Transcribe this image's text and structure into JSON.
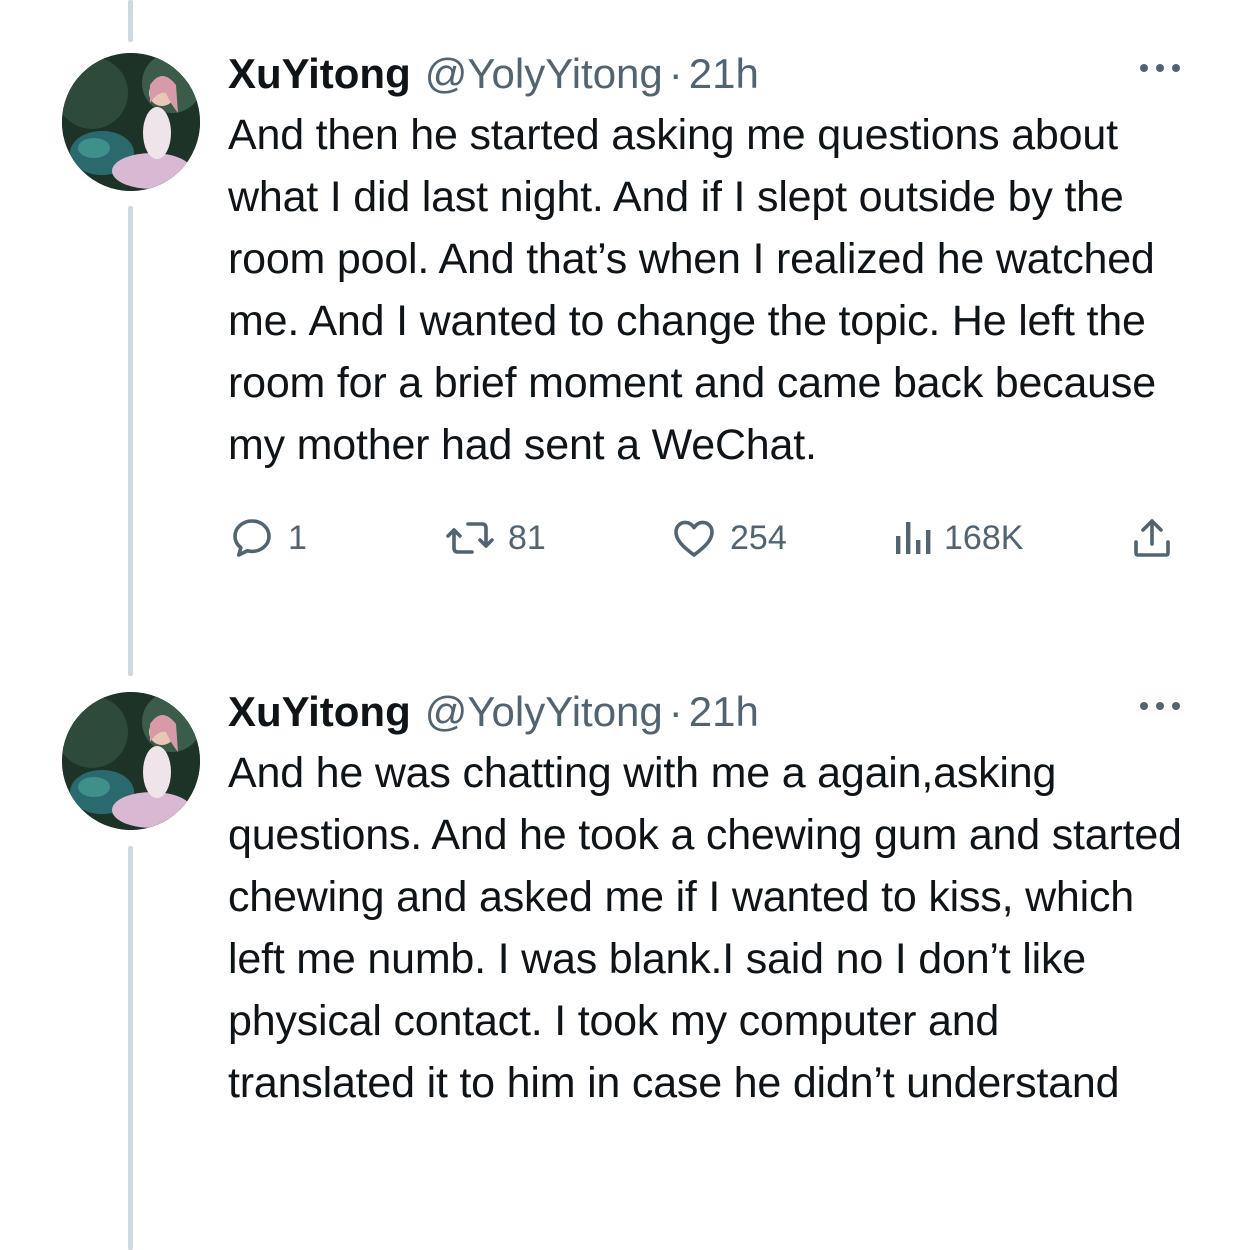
{
  "tweets": [
    {
      "display_name": "XuYitong",
      "handle": "@YolyYitong",
      "separator": "·",
      "time": "21h",
      "text": "And then he started asking me questions about what I did last night. And if I slept outside by the room pool. And that’s when I realized he watched me. And I wanted to change the topic. He left the room for a brief moment and came back because my mother had sent a WeChat.",
      "replies": "1",
      "retweets": "81",
      "likes": "254",
      "views": "168K"
    },
    {
      "display_name": "XuYitong",
      "handle": "@YolyYitong",
      "separator": "·",
      "time": "21h",
      "text": "And he was chatting with me a again,asking questions. And he took a chewing gum and started chewing and asked me if I wanted to kiss, which left me numb. I was blank.I said no I don’t like physical contact. I took my computer and translated it to him in case he didn’t understand"
    }
  ],
  "icons": {
    "reply": "reply-icon",
    "retweet": "retweet-icon",
    "like": "heart-icon",
    "views": "views-icon",
    "share": "share-icon",
    "more": "more-icon"
  },
  "colors": {
    "text": "#0f1419",
    "secondary": "#536471",
    "thread_line": "#cfd9de"
  }
}
